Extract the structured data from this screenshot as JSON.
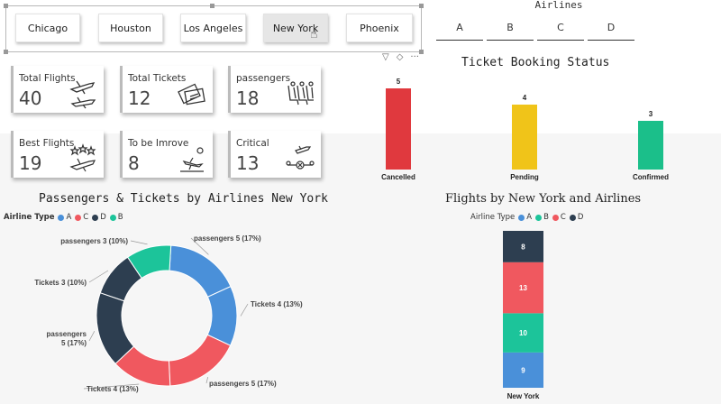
{
  "city_slicer": {
    "items": [
      "Chicago",
      "Houston",
      "Los Angeles",
      "New York",
      "Phoenix"
    ],
    "selected": "New York"
  },
  "airline_slicer": {
    "title": "Airlines",
    "items": [
      "A",
      "B",
      "C",
      "D"
    ]
  },
  "cards": [
    {
      "title": "Total Flights",
      "value": "40",
      "icon": "airplanes-icon"
    },
    {
      "title": "Total Tickets",
      "value": "12",
      "icon": "tickets-icon"
    },
    {
      "title": "passengers",
      "value": "18",
      "icon": "seats-icon"
    },
    {
      "title": "Best Flights",
      "value": "19",
      "icon": "star-plane-icon"
    },
    {
      "title": "To be Imrove",
      "value": "8",
      "icon": "landing-plane-icon"
    },
    {
      "title": "Critical",
      "value": "13",
      "icon": "route-cancel-icon"
    }
  ],
  "colors": {
    "A": "#4a90d9",
    "B": "#1cc49a",
    "C": "#f0585f",
    "D": "#2d3e50",
    "cancelled": "#e0393e",
    "pending": "#f0c419",
    "confirmed": "#1bbf8a"
  },
  "booking_chart": {
    "title": "Ticket Booking Status",
    "chart_data": {
      "type": "bar",
      "categories": [
        "Cancelled",
        "Pending",
        "Confirmed"
      ],
      "values": [
        5,
        4,
        3
      ]
    }
  },
  "donut_chart": {
    "title": "Passengers & Tickets by Airlines New York",
    "legend_title": "Airline Type",
    "legend": [
      "A",
      "C",
      "D",
      "B"
    ],
    "chart_data": {
      "type": "pie",
      "categories": [
        "passengers 5 (17%)",
        "Tickets 4 (13%)",
        "passengers 5 (17%)",
        "Tickets 4 (13%)",
        "passengers 5 (17%)",
        "Tickets 3 (10%)",
        "passengers 3 (10%)"
      ],
      "values": [
        5,
        4,
        5,
        4,
        5,
        3,
        3
      ],
      "series_colors": [
        "A",
        "A",
        "C",
        "C",
        "D",
        "D",
        "B"
      ]
    }
  },
  "stack_chart": {
    "title": "Flights by New York and Airlines",
    "legend_title": "Airline Type",
    "legend": [
      "A",
      "B",
      "C",
      "D"
    ],
    "chart_data": {
      "type": "bar",
      "categories": [
        "New York"
      ],
      "series": [
        {
          "name": "A",
          "values": [
            9
          ]
        },
        {
          "name": "B",
          "values": [
            10
          ]
        },
        {
          "name": "C",
          "values": [
            13
          ]
        },
        {
          "name": "D",
          "values": [
            8
          ]
        }
      ]
    }
  }
}
